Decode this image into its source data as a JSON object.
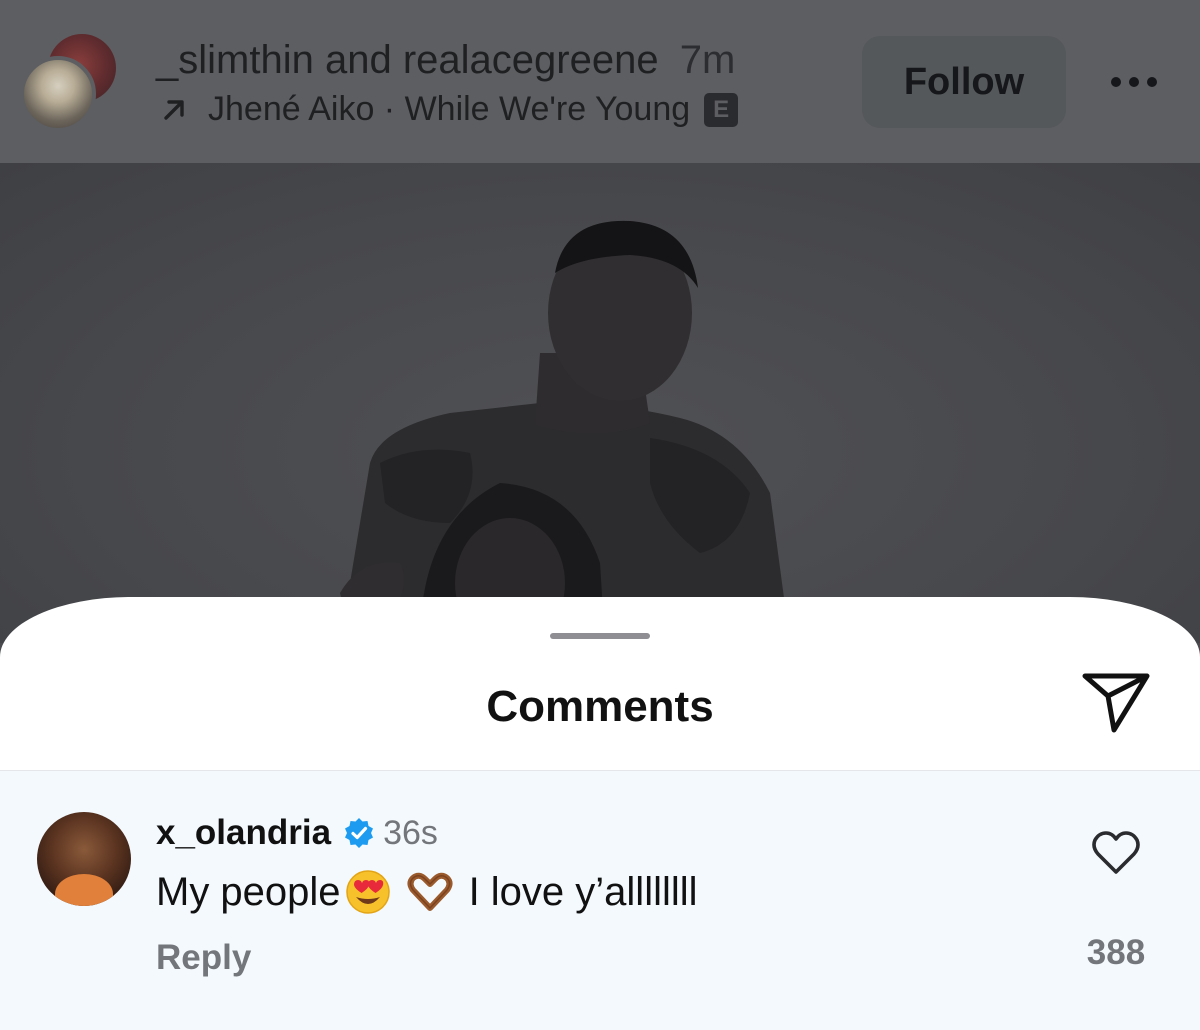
{
  "post": {
    "user1": "_slimthin",
    "and_text": "and",
    "user2": "realacegreene",
    "time": "7m",
    "music": "Jhené Aiko · While We're Young",
    "explicit_badge": "E",
    "follow_label": "Follow",
    "more_icon": "more-horizontal-icon",
    "arrow_icon": "arrow-up-right-icon"
  },
  "sheet": {
    "title": "Comments",
    "send_icon": "paper-plane-icon"
  },
  "comment": {
    "username": "x_olandria",
    "verified_icon": "verified-badge-icon",
    "verified_color": "#1d9bf0",
    "time": "36s",
    "text_part1": "My people",
    "emojis": [
      "heart-eyes-emoji",
      "heart-hands-emoji"
    ],
    "text_part2": "I love y’allllllll",
    "reply_label": "Reply",
    "like_icon": "heart-outline-icon",
    "like_count": "388"
  },
  "colors": {
    "overlay": "#5d5e62",
    "sheet_bg": "#ffffff",
    "comment_highlight": "#f3f9fd",
    "secondary_text": "#73767b"
  }
}
